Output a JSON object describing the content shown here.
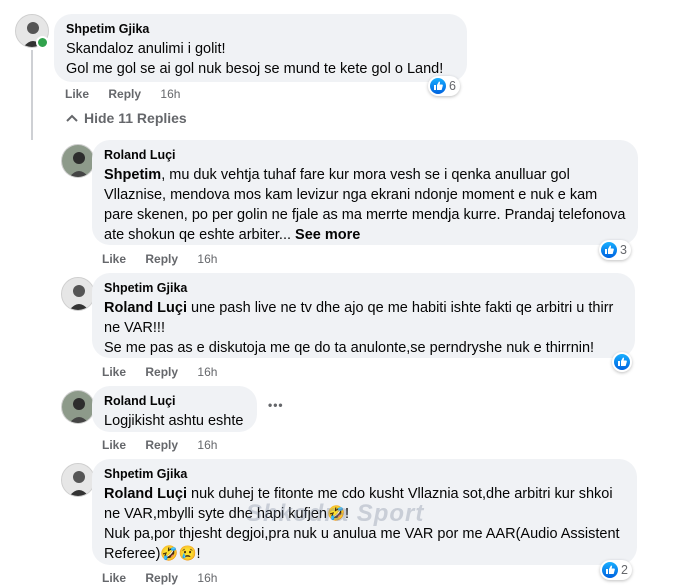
{
  "comment": {
    "author": "Shpetim Gjika",
    "line1": "Skandaloz anulimi i golit!",
    "line2": "Gol me gol se ai gol nuk besoj se mund te kete gol o Land!",
    "like": "Like",
    "reply": "Reply",
    "time": "16h",
    "reactions": "6"
  },
  "hide_replies": "Hide 11 Replies",
  "replies": [
    {
      "author": "Roland Luçi",
      "mention": "Shpetim",
      "text": ", mu duk vehtja tuhaf fare kur mora vesh se i qenka anulluar gol Vllaznise, mendova mos kam levizur nga ekrani ndonje moment e nuk e kam pare skenen, po per golin ne fjale as ma merrte mendja kurre. Prandaj telefonova ate shokun qe eshte arbiter...",
      "see_more": "See more",
      "like": "Like",
      "reply": "Reply",
      "time": "16h",
      "reactions": "3"
    },
    {
      "author": "Shpetim Gjika",
      "mention": "Roland Luçi",
      "text": " une pash live ne tv dhe ajo qe me habiti ishte fakti qe arbitri u thirr ne VAR!!!",
      "text2": "Se me pas as e diskutoja me qe do ta anulonte,se perndryshe nuk e thirrnin!",
      "like": "Like",
      "reply": "Reply",
      "time": "16h"
    },
    {
      "author": "Roland Luçi",
      "text": "Logjikisht ashtu eshte",
      "more": "•••",
      "like": "Like",
      "reply": "Reply",
      "time": "16h"
    },
    {
      "author": "Shpetim Gjika",
      "mention": "Roland Luçi",
      "text": " nuk duhej te fitonte me cdo kusht Vllaznia sot,dhe arbitri kur shkoi ne VAR,mbylli syte dhe hapi kufjen🤣!",
      "text2": "Nuk pa,por thjesht degjoi,pra nuk u anulua me VAR por me AAR(Audio Assistent Referee)🤣😢!",
      "like": "Like",
      "reply": "Reply",
      "time": "16h",
      "reactions": "2"
    }
  ],
  "watermark": "Shkodra Sport",
  "icons": {
    "like": "like-icon",
    "chevron": "chevron-up-icon",
    "more": "more-options-icon"
  },
  "colors": {
    "bubble": "#f0f2f5",
    "meta": "#65676b",
    "like_blue": "#0866ff",
    "online": "#31a24c"
  }
}
